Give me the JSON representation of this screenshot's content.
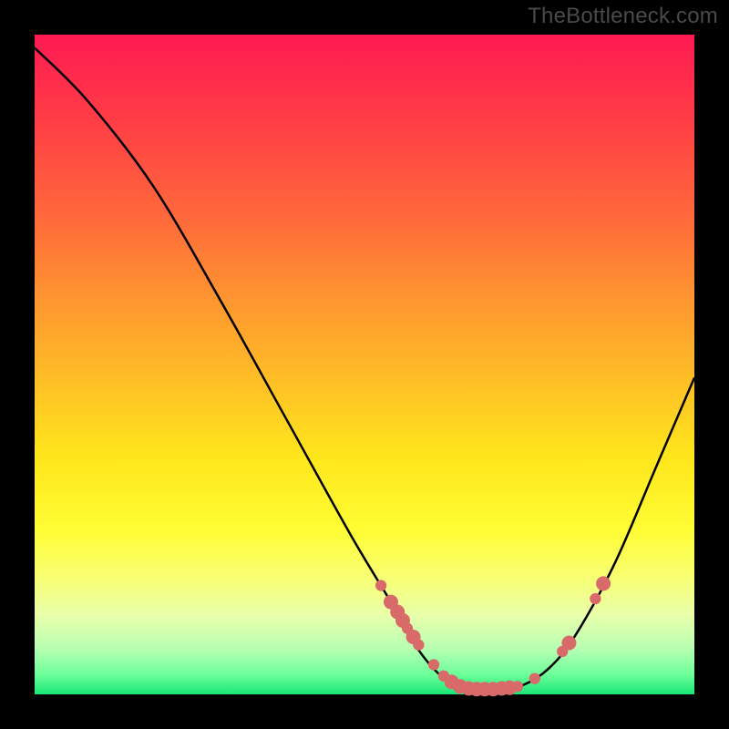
{
  "attribution": "TheBottleneck.com",
  "colors": {
    "marker": "#d96a6a",
    "curve": "#000000"
  },
  "chart_data": {
    "type": "line",
    "title": "",
    "xlabel": "",
    "ylabel": "",
    "xlim": [
      0,
      100
    ],
    "ylim": [
      0,
      100
    ],
    "curve_points": [
      {
        "x": 0.0,
        "y": 98.0
      },
      {
        "x": 8.0,
        "y": 90.0
      },
      {
        "x": 18.0,
        "y": 77.0
      },
      {
        "x": 28.0,
        "y": 60.0
      },
      {
        "x": 38.0,
        "y": 42.0
      },
      {
        "x": 48.0,
        "y": 24.0
      },
      {
        "x": 54.0,
        "y": 14.0
      },
      {
        "x": 58.0,
        "y": 7.0
      },
      {
        "x": 62.0,
        "y": 2.5
      },
      {
        "x": 66.0,
        "y": 1.0
      },
      {
        "x": 70.0,
        "y": 0.8
      },
      {
        "x": 74.0,
        "y": 1.4
      },
      {
        "x": 78.0,
        "y": 4.0
      },
      {
        "x": 82.0,
        "y": 9.0
      },
      {
        "x": 88.0,
        "y": 20.0
      },
      {
        "x": 94.0,
        "y": 34.0
      },
      {
        "x": 100.0,
        "y": 48.0
      }
    ],
    "markers": [
      {
        "x": 52.5,
        "y": 16.5,
        "r": 1.0
      },
      {
        "x": 54.0,
        "y": 14.0,
        "r": 1.3
      },
      {
        "x": 55.0,
        "y": 12.5,
        "r": 1.3
      },
      {
        "x": 55.8,
        "y": 11.2,
        "r": 1.3
      },
      {
        "x": 56.5,
        "y": 10.0,
        "r": 1.0
      },
      {
        "x": 57.4,
        "y": 8.7,
        "r": 1.3
      },
      {
        "x": 58.2,
        "y": 7.5,
        "r": 1.0
      },
      {
        "x": 60.5,
        "y": 4.5,
        "r": 1.0
      },
      {
        "x": 62.0,
        "y": 2.8,
        "r": 1.0
      },
      {
        "x": 63.2,
        "y": 1.9,
        "r": 1.3
      },
      {
        "x": 64.5,
        "y": 1.2,
        "r": 1.3
      },
      {
        "x": 65.8,
        "y": 0.9,
        "r": 1.3
      },
      {
        "x": 67.0,
        "y": 0.8,
        "r": 1.3
      },
      {
        "x": 68.2,
        "y": 0.8,
        "r": 1.3
      },
      {
        "x": 69.5,
        "y": 0.8,
        "r": 1.3
      },
      {
        "x": 70.8,
        "y": 0.9,
        "r": 1.3
      },
      {
        "x": 72.0,
        "y": 1.0,
        "r": 1.3
      },
      {
        "x": 73.2,
        "y": 1.2,
        "r": 1.0
      },
      {
        "x": 75.8,
        "y": 2.4,
        "r": 1.0
      },
      {
        "x": 80.0,
        "y": 6.5,
        "r": 1.0
      },
      {
        "x": 81.0,
        "y": 7.8,
        "r": 1.3
      },
      {
        "x": 85.0,
        "y": 14.5,
        "r": 1.0
      },
      {
        "x": 86.2,
        "y": 16.8,
        "r": 1.3
      }
    ]
  }
}
